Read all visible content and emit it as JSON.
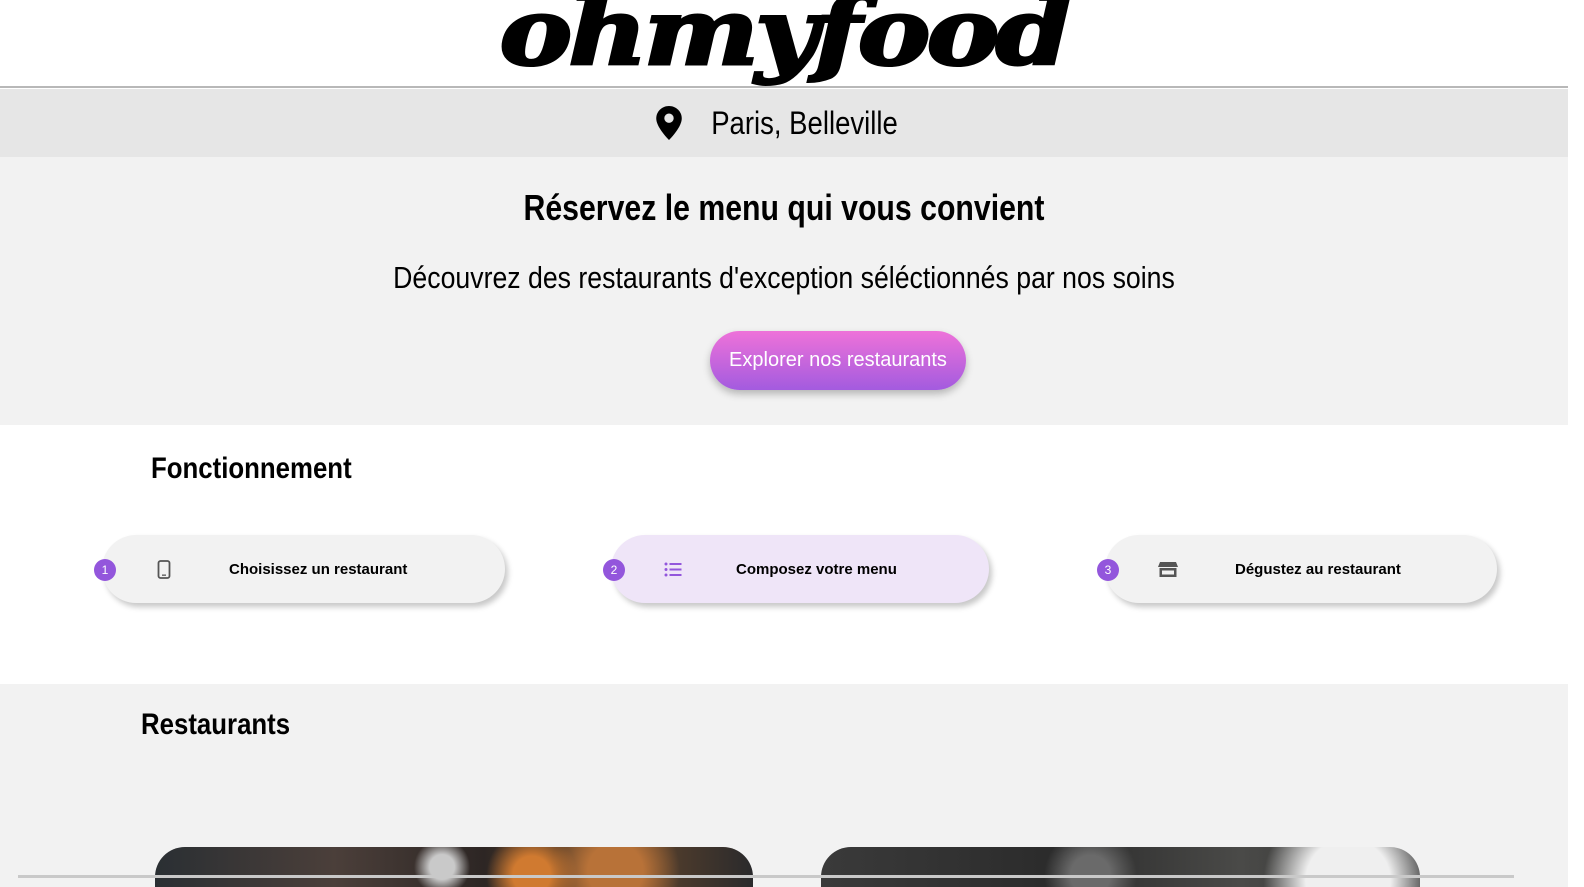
{
  "header": {
    "logo_text": "ohmyfood"
  },
  "location": {
    "icon": "location-pin-icon",
    "city": "Paris, Belleville"
  },
  "hero": {
    "title": "Réservez le menu qui vous convient",
    "subtitle": "Découvrez des restaurants d'exception séléctionnés par nos soins",
    "cta_label": "Explorer nos restaurants"
  },
  "how_it_works": {
    "title": "Fonctionnement",
    "steps": [
      {
        "number": "1",
        "icon": "mobile-phone-icon",
        "label": "Choisissez un restaurant"
      },
      {
        "number": "2",
        "icon": "list-icon",
        "label": "Composez votre menu"
      },
      {
        "number": "3",
        "icon": "store-icon",
        "label": "Dégustez au restaurant"
      }
    ]
  },
  "restaurants": {
    "title": "Restaurants"
  },
  "colors": {
    "accent_purple": "#9356dc",
    "button_gradient_top": "#ee72d9",
    "button_gradient_bottom": "#a35bdf",
    "active_step_background": "#efe5f8"
  }
}
